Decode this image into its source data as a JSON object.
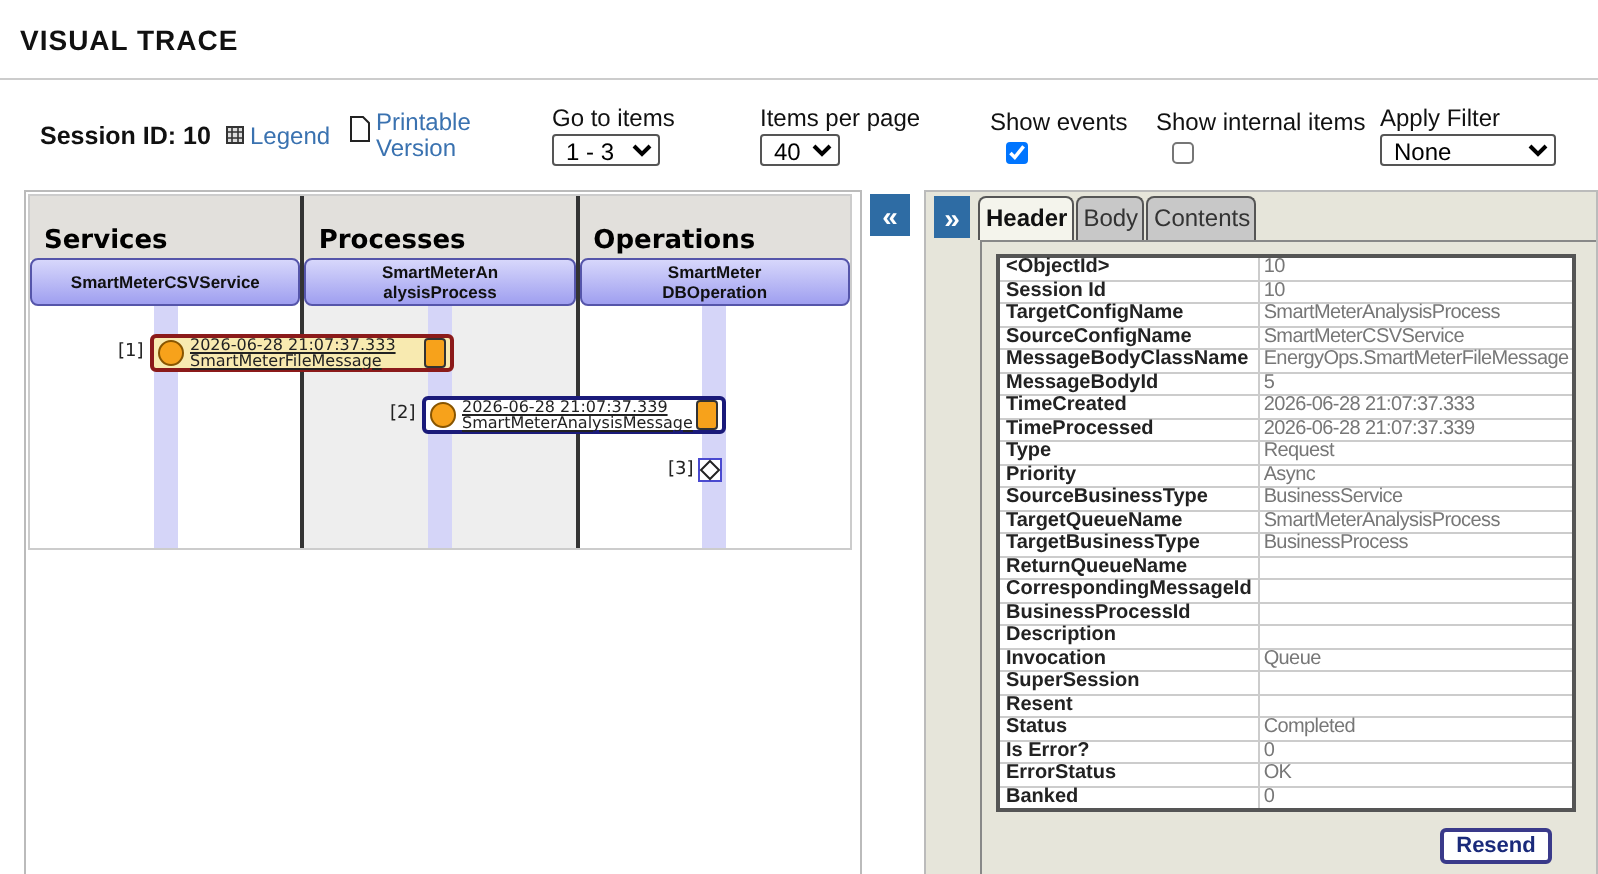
{
  "title": "VISUAL TRACE",
  "toolbar": {
    "session": "Session ID: 10",
    "legend": "Legend",
    "printable": "Printable Version",
    "goto": {
      "label": "Go to items",
      "value": "1 - 3"
    },
    "per_page": {
      "label": "Items per page",
      "value": "40"
    },
    "show_events": {
      "label": "Show events",
      "checked": true
    },
    "show_internal": {
      "label": "Show internal items",
      "checked": false
    },
    "filter": {
      "label": "Apply Filter",
      "value": "None"
    }
  },
  "diagram": {
    "collapse": "«",
    "columns": [
      {
        "title": "Services",
        "host": "SmartMeterCSVService",
        "shaded": false
      },
      {
        "title": "Processes",
        "host": "SmartMeterAn alysisProcess",
        "shaded": true
      },
      {
        "title": "Operations",
        "host": "SmartMeter DBOperation",
        "shaded": false
      }
    ],
    "messages": [
      {
        "kind": "message",
        "index": "[1]",
        "time": "2026-06-28 21:07:37.333",
        "name": "SmartMeterFileMessage",
        "selected": true
      },
      {
        "kind": "message",
        "index": "[2]",
        "time": "2026-06-28 21:07:37.339",
        "name": "SmartMeterAnalysisMessage",
        "selected": false
      },
      {
        "kind": "event",
        "index": "[3]"
      }
    ]
  },
  "details": {
    "expand": "»",
    "tabs": [
      {
        "label": "Header",
        "selected": true
      },
      {
        "label": "Body",
        "selected": false
      },
      {
        "label": "Contents",
        "selected": false
      }
    ],
    "rows": [
      [
        "<ObjectId>",
        "10"
      ],
      [
        "Session Id",
        "10"
      ],
      [
        "TargetConfigName",
        "SmartMeterAnalysisProcess"
      ],
      [
        "SourceConfigName",
        "SmartMeterCSVService"
      ],
      [
        "MessageBodyClassName",
        "EnergyOps.SmartMeterFileMessage"
      ],
      [
        "MessageBodyId",
        "5"
      ],
      [
        "TimeCreated",
        "2026-06-28 21:07:37.333"
      ],
      [
        "TimeProcessed",
        "2026-06-28 21:07:37.339"
      ],
      [
        "Type",
        "Request"
      ],
      [
        "Priority",
        "Async"
      ],
      [
        "SourceBusinessType",
        "BusinessService"
      ],
      [
        "TargetQueueName",
        "SmartMeterAnalysisProcess"
      ],
      [
        "TargetBusinessType",
        "BusinessProcess"
      ],
      [
        "ReturnQueueName",
        ""
      ],
      [
        "CorrespondingMessageId",
        ""
      ],
      [
        "BusinessProcessId",
        ""
      ],
      [
        "Description",
        ""
      ],
      [
        "Invocation",
        "Queue"
      ],
      [
        "SuperSession",
        ""
      ],
      [
        "Resent",
        ""
      ],
      [
        "Status",
        "Completed"
      ],
      [
        "Is Error?",
        "0"
      ],
      [
        "ErrorStatus",
        "OK"
      ],
      [
        "Banked",
        "0"
      ]
    ],
    "resend": "Resend"
  }
}
